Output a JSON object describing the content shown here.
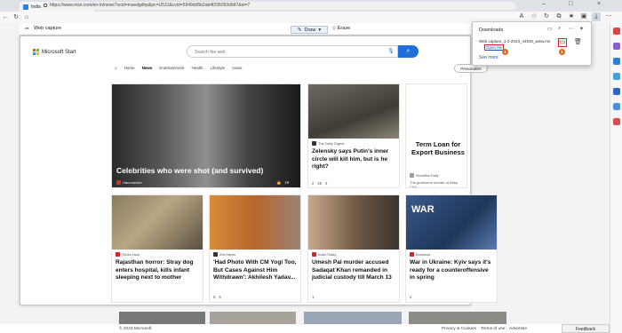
{
  "browser": {
    "tab_title": "India News, Politics News and Inf",
    "url": "https://www.msn.com/en-in/news?ocid=msedgdhp&pc=U531&cvid=5949dd5b2ab4f295093d9d7&ei=7"
  },
  "capture_bar": {
    "title": "Web capture",
    "draw_label": "Draw",
    "erase_label": "Erase"
  },
  "site": {
    "logo_text": "Microsoft Start",
    "search_placeholder": "Search the web",
    "nav": [
      "Home",
      "News",
      "Entertainment",
      "Health",
      "Lifestyle",
      "Autos"
    ],
    "personalize_label": "Personalize"
  },
  "cards": {
    "hero": {
      "title": "Celebrities who were shot (and survived)",
      "source": "Hannmeider",
      "likes": "19"
    },
    "zelensky": {
      "source": "The Daily Digest",
      "title": "Zelensky says Putin's inner circle will kill him, but is he right?",
      "likes": "2",
      "dislikes": "25",
      "comments": "4"
    },
    "loan": {
      "ad_title": "Term Loan for Export Business",
      "source": "ShowBiz Daily",
      "title": "The gruesome murder of Abby Choi..."
    },
    "rajasthan": {
      "source": "Times Now",
      "title": "Rajasthan horror: Stray dog enters hospital, kills infant sleeping next to mother"
    },
    "yogi": {
      "source": "Zee News",
      "title": "'Had Photo With CM Yogi Too, But Cases Against Him Withdrawn': Akhilesh Yadav...",
      "likes": "5",
      "comments": "5"
    },
    "umesh": {
      "source": "India Today",
      "title": "Umesh Pal murder accused Sadaqat Khan remanded in judicial custody till March 13",
      "likes": "1"
    },
    "ukraine": {
      "source": "Business",
      "title": "War in Ukraine: Kyiv says it's ready for a counteroffensive in spring",
      "likes": "2",
      "overlay": "WAR"
    }
  },
  "downloads": {
    "title": "Downloads",
    "file_name": "Web capture_1-3-2023_44930_www.msn.jpeg",
    "open_label": "Open file",
    "see_more": "See more",
    "badge1": "1",
    "badge2": "2"
  },
  "footer": {
    "copyright": "© 2023 Microsoft",
    "links": [
      "Privacy & Cookies",
      "Terms of use",
      "Advertise"
    ],
    "feedback": "Feedback"
  },
  "colors": {
    "accent": "#1e6fd9",
    "badge": "#e2651e",
    "highlight": "#dd2222"
  }
}
